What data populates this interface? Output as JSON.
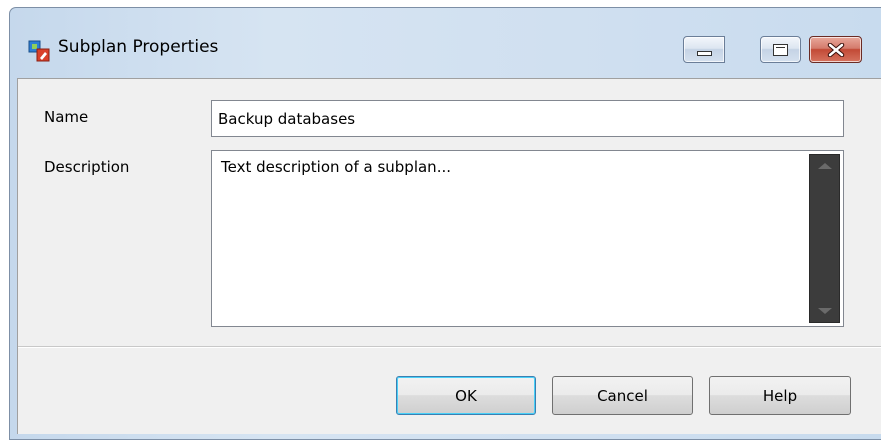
{
  "window": {
    "title": "Subplan Properties",
    "icon": "subplan-icon",
    "controls": {
      "minimize_icon": "minimize-icon",
      "maximize_icon": "maximize-icon",
      "close_icon": "close-icon"
    }
  },
  "form": {
    "name_label": "Name",
    "name_value": "Backup databases",
    "description_label": "Description",
    "description_value": "Text description of a subplan..."
  },
  "buttons": {
    "ok": "OK",
    "cancel": "Cancel",
    "help": "Help"
  },
  "colors": {
    "title_bar": "#c5d8ec",
    "close_button": "#c24a36",
    "client_bg": "#f0f0f0",
    "scrollbar": "#3c3c3c",
    "default_button_focus": "#48d0f8"
  }
}
